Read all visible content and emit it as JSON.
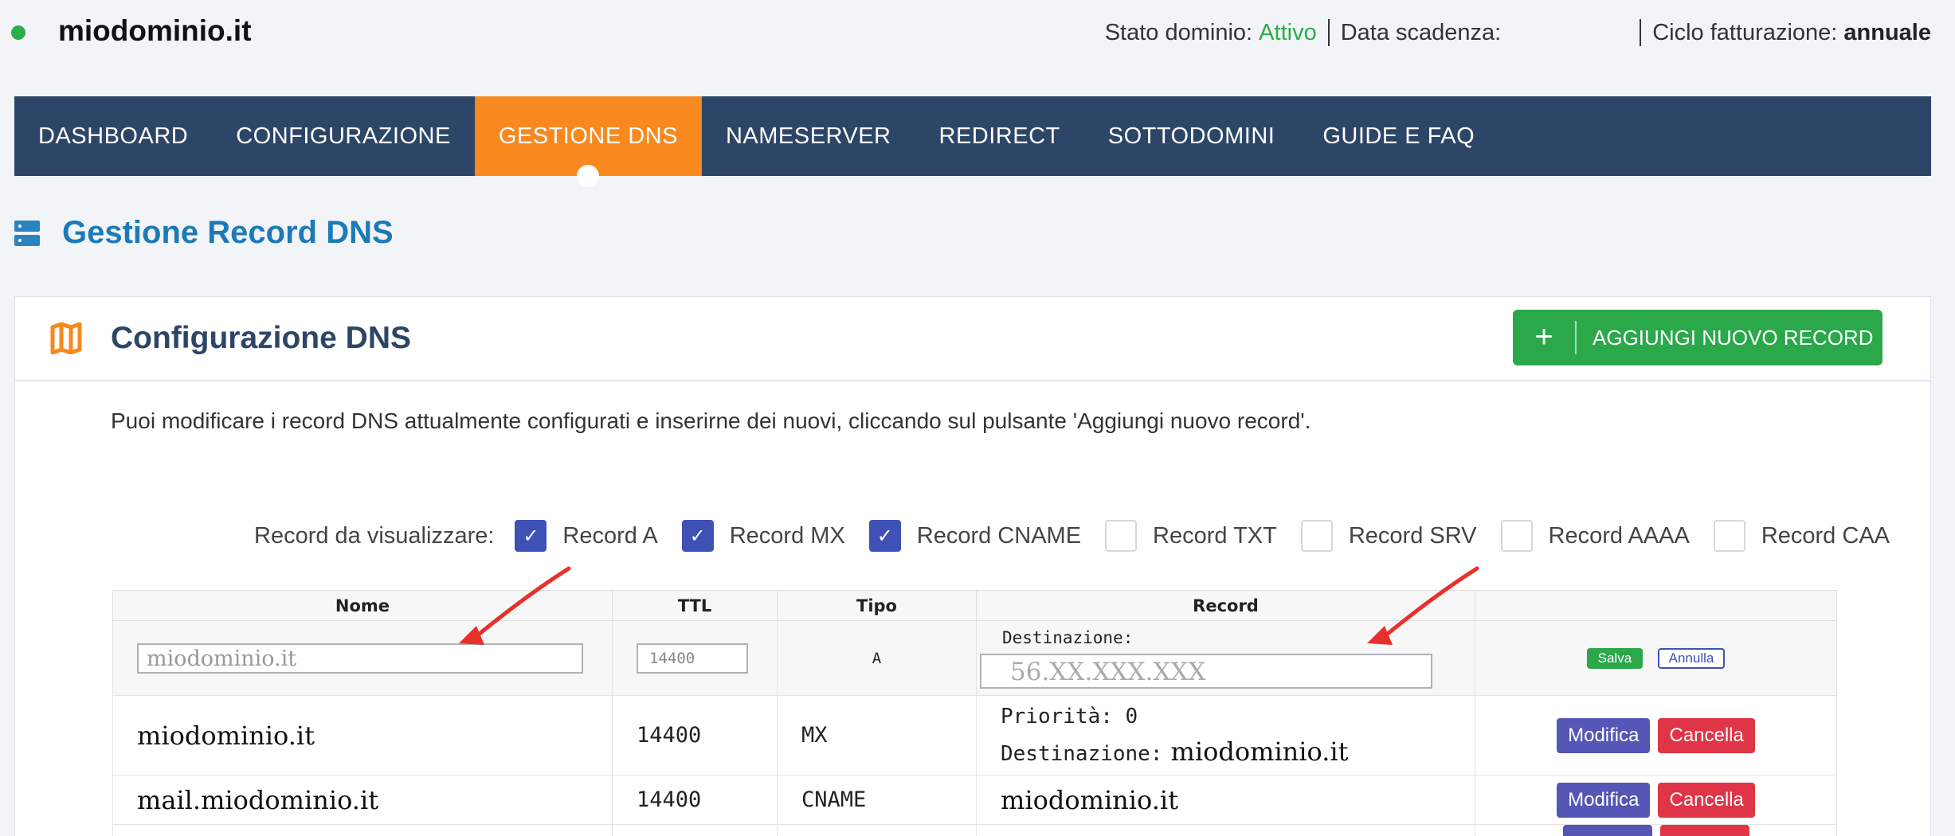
{
  "header": {
    "domain": "miodominio.it",
    "status_label": "Stato dominio:",
    "status_value": "Attivo",
    "expiry_label": "Data scadenza:",
    "expiry_value": "",
    "billing_label": "Ciclo fatturazione:",
    "billing_value": "annuale"
  },
  "nav": {
    "items": [
      {
        "label": "DASHBOARD"
      },
      {
        "label": "CONFIGURAZIONE"
      },
      {
        "label": "GESTIONE DNS",
        "active": true
      },
      {
        "label": "NAMESERVER"
      },
      {
        "label": "REDIRECT"
      },
      {
        "label": "SOTTODOMINI"
      },
      {
        "label": "GUIDE E FAQ"
      }
    ]
  },
  "section": {
    "title": "Gestione Record DNS",
    "icon": "server-icon"
  },
  "card": {
    "title": "Configurazione DNS",
    "icon": "map-icon",
    "add_button": {
      "icon": "+",
      "label": "AGGIUNGI NUOVO RECORD"
    },
    "intro": "Puoi modificare i record DNS attualmente configurati e inserirne dei nuovi, cliccando sul pulsante 'Aggiungi nuovo record'."
  },
  "filters": {
    "label": "Record da visualizzare:",
    "items": [
      {
        "label": "Record A",
        "checked": true
      },
      {
        "label": "Record MX",
        "checked": true
      },
      {
        "label": "Record CNAME",
        "checked": true
      },
      {
        "label": "Record TXT",
        "checked": false
      },
      {
        "label": "Record SRV",
        "checked": false
      },
      {
        "label": "Record AAAA",
        "checked": false
      },
      {
        "label": "Record CAA",
        "checked": false
      }
    ]
  },
  "table": {
    "headers": {
      "nome": "Nome",
      "ttl": "TTL",
      "tipo": "Tipo",
      "record": "Record",
      "actions": ""
    },
    "edit_row": {
      "name_value": "miodominio.it",
      "ttl_value": "14400",
      "tipo": "A",
      "dest_label": "Destinazione:",
      "record_value": "56.XX.XXX.XXX",
      "save_label": "Salva",
      "cancel_label": "Annulla"
    },
    "rows": [
      {
        "nome": "miodominio.it",
        "ttl": "14400",
        "tipo": "MX",
        "priority_label": "Priorità:",
        "priority_value": "0",
        "dest_label": "Destinazione:",
        "dest_value": "miodominio.it",
        "edit_label": "Modifica",
        "delete_label": "Cancella"
      },
      {
        "nome": "mail.miodominio.it",
        "ttl": "14400",
        "tipo": "CNAME",
        "record": "miodominio.it",
        "edit_label": "Modifica",
        "delete_label": "Cancella"
      }
    ]
  },
  "colors": {
    "nav_bg": "#2d4567",
    "nav_active": "#f7891e",
    "accent_blue": "#1c7ab8",
    "success": "#2aa84a",
    "danger": "#df3547",
    "primary": "#5556b5",
    "annotation_arrow": "#e8302a"
  }
}
